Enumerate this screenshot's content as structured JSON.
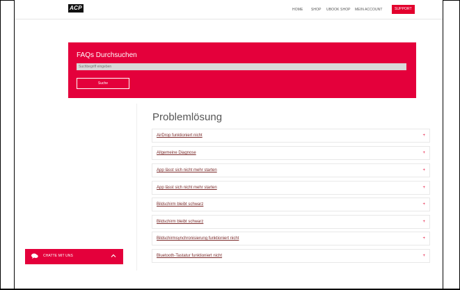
{
  "header": {
    "logo": "ACP",
    "nav": [
      {
        "label": "HOME"
      },
      {
        "label": "SHOP"
      },
      {
        "label": "UBOOK SHOP"
      },
      {
        "label": "MEIN ACCOUNT"
      },
      {
        "label": "SUPPORT"
      }
    ]
  },
  "search": {
    "title": "FAQs Durchsuchen",
    "placeholder": "Suchbegriff eingeben",
    "button": "Suche"
  },
  "section": {
    "title": "Problemlösung",
    "items": [
      {
        "label": "AirDrop funktioniert nicht"
      },
      {
        "label": "Allgemeine Diagnose"
      },
      {
        "label": "App lässt sich nicht mehr starten"
      },
      {
        "label": "App lässt sich nicht mehr starten"
      },
      {
        "label": "Bildschirm bleibt schwarz"
      },
      {
        "label": "Bildschirm bleibt schwarz"
      },
      {
        "label": "Bildschirmsynchronisierung funktioniert nicht"
      },
      {
        "label": "Bluetooth-Tastatur funktioniert nicht"
      }
    ]
  },
  "chat": {
    "label": "CHATTE MIT UNS"
  },
  "colors": {
    "accent": "#e4003b"
  }
}
